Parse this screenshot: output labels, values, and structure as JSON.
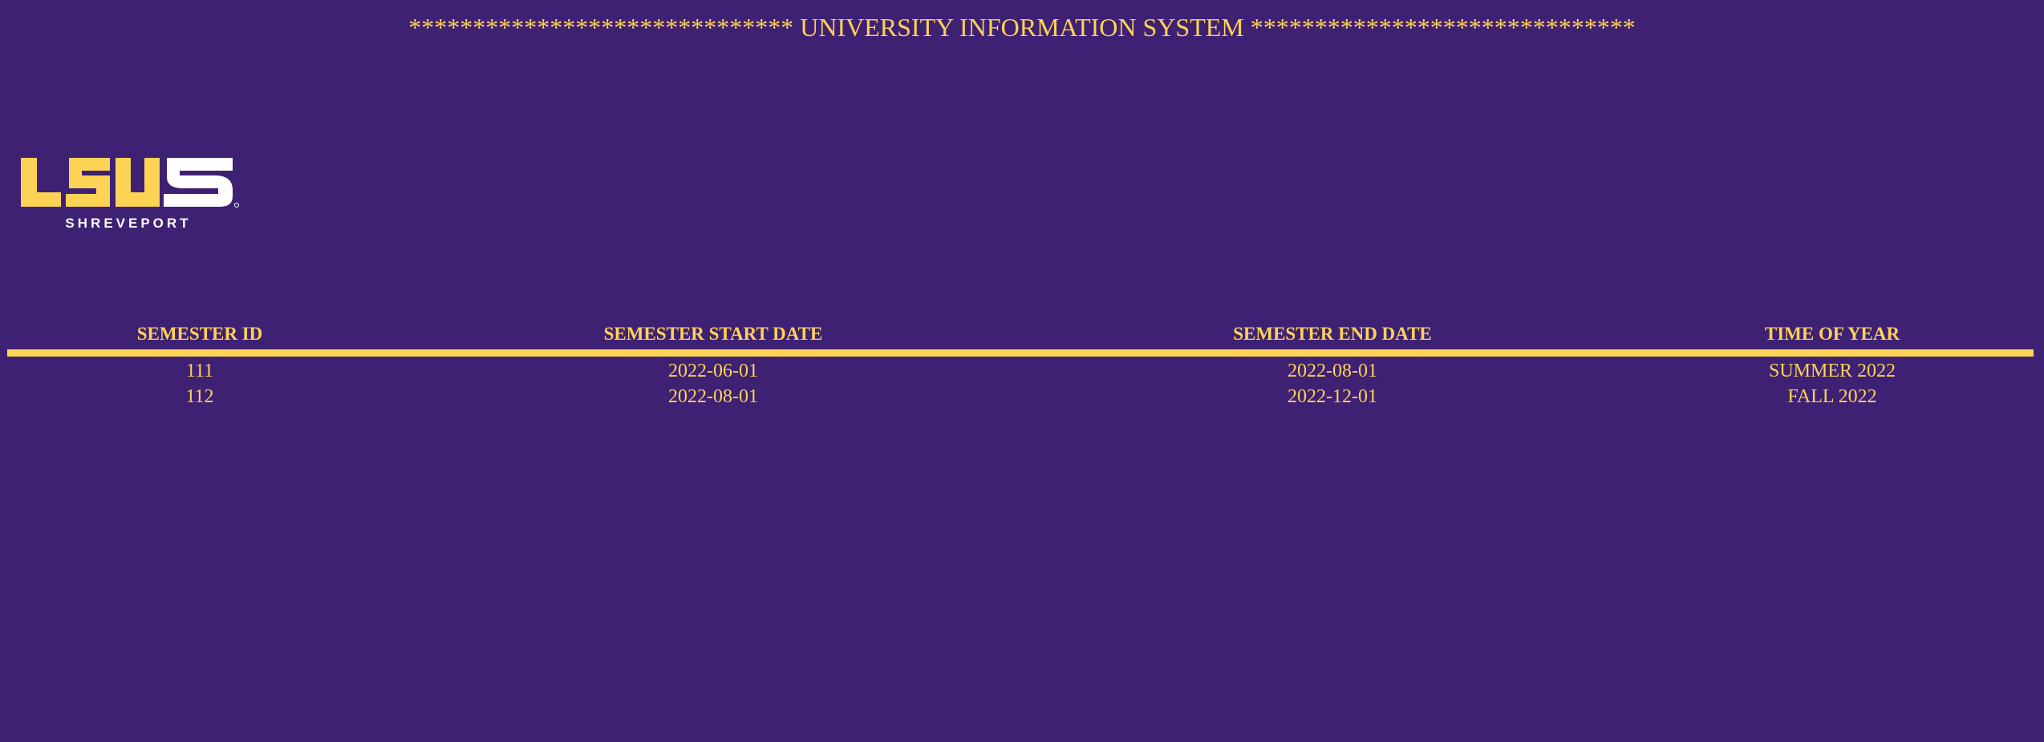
{
  "header": {
    "title": "****************************** UNIVERSITY INFORMATION SYSTEM ******************************"
  },
  "logo": {
    "wordmark": "LSUS",
    "subtitle": "SHREVEPORT"
  },
  "table": {
    "columns": [
      "SEMESTER ID",
      "SEMESTER START DATE",
      "SEMESTER END DATE",
      "TIME OF YEAR"
    ],
    "rows": [
      [
        "111",
        "2022-06-01",
        "2022-08-01",
        "SUMMER 2022"
      ],
      [
        "112",
        "2022-08-01",
        "2022-12-01",
        "FALL 2022"
      ]
    ]
  },
  "colors": {
    "background": "#3f2174",
    "accent": "#fdd356",
    "logo_white": "#ffffff"
  }
}
